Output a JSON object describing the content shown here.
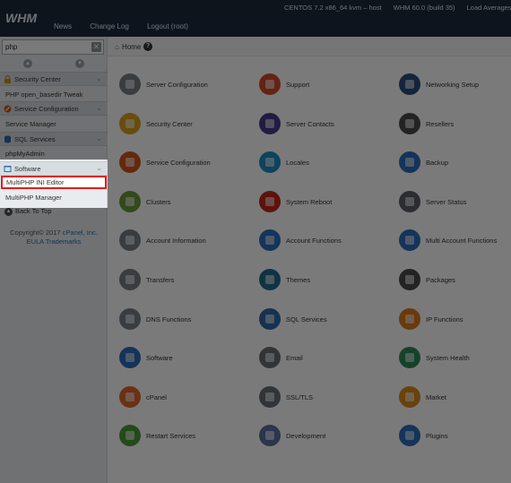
{
  "topbar": {
    "logo": "WHM",
    "nav": [
      "News",
      "Change Log",
      "Logout (root)"
    ],
    "info": [
      "CENTOS 7.2 x86_64 kvm – host",
      "WHM 60.0 (build 35)",
      "Load Averages:"
    ]
  },
  "sidebar": {
    "search_value": "php",
    "clear_label": "✕",
    "groups": [
      {
        "label": "Security Center",
        "items": [
          "PHP open_basedir Tweak"
        ]
      },
      {
        "label": "Service Configuration",
        "items": [
          "Service Manager"
        ]
      },
      {
        "label": "SQL Services",
        "items": [
          "phpMyAdmin"
        ]
      },
      {
        "label": "Software",
        "items": [
          "MultiPHP INI Editor",
          "MultiPHP Manager"
        ]
      }
    ],
    "back_to_top": "Back To Top",
    "copyright": "Copyright© 2017",
    "cpanel_link": "cPanel, Inc.",
    "eula": "EULA",
    "trademarks": "Trademarks"
  },
  "breadcrumb": {
    "home": "Home",
    "help": "?"
  },
  "tiles": [
    [
      "Server Configuration",
      "Support",
      "Networking Setup"
    ],
    [
      "Security Center",
      "Server Contacts",
      "Resellers"
    ],
    [
      "Service Configuration",
      "Locales",
      "Backup"
    ],
    [
      "Clusters",
      "System Reboot",
      "Server Status"
    ],
    [
      "Account Information",
      "Account Functions",
      "Multi Account Functions"
    ],
    [
      "Transfers",
      "Themes",
      "Packages"
    ],
    [
      "DNS Functions",
      "SQL Services",
      "IP Functions"
    ],
    [
      "Software",
      "Email",
      "System Health"
    ],
    [
      "cPanel",
      "SSL/TLS",
      "Market"
    ],
    [
      "Restart Services",
      "Development",
      "Plugins"
    ]
  ]
}
